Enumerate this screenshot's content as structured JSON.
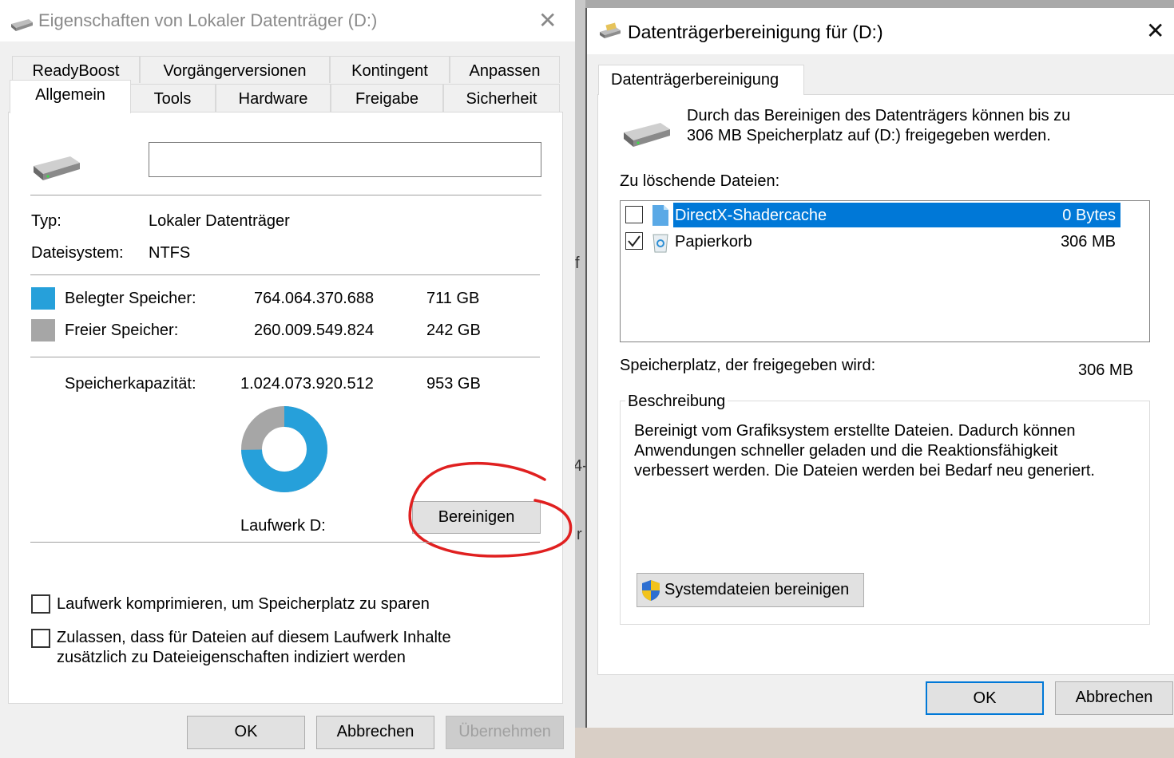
{
  "left_window": {
    "title": "Eigenschaften von Lokaler Datenträger (D:)",
    "tabs_row1": [
      "ReadyBoost",
      "Vorgängerversionen",
      "Kontingent",
      "Anpassen"
    ],
    "tabs_row2": [
      "Allgemein",
      "Tools",
      "Hardware",
      "Freigabe",
      "Sicherheit"
    ],
    "active_tab": "Allgemein",
    "name_value": "",
    "type_label": "Typ:",
    "type_value": "Lokaler Datenträger",
    "fs_label": "Dateisystem:",
    "fs_value": "NTFS",
    "used_label": "Belegter Speicher:",
    "used_bytes": "764.064.370.688",
    "used_gb": "711 GB",
    "free_label": "Freier Speicher:",
    "free_bytes": "260.009.549.824",
    "free_gb": "242 GB",
    "capacity_label": "Speicherkapazität:",
    "capacity_bytes": "1.024.073.920.512",
    "capacity_gb": "953 GB",
    "drive_label": "Laufwerk D:",
    "cleanup_button": "Bereinigen",
    "compress_label": "Laufwerk komprimieren, um Speicherplatz zu sparen",
    "index_label_line1": "Zulassen, dass für Dateien auf diesem Laufwerk Inhalte",
    "index_label_line2": "zusätzlich zu Dateieigenschaften indiziert werden",
    "ok_button": "OK",
    "cancel_button": "Abbrechen",
    "apply_button": "Übernehmen",
    "used_color": "#26a0da",
    "free_color": "#a6a6a6",
    "used_fraction": 0.746
  },
  "right_window": {
    "title": "Datenträgerbereinigung für  (D:)",
    "tab": "Datenträgerbereinigung",
    "intro_line1": "Durch das Bereinigen des Datenträgers können bis zu",
    "intro_line2": "306 MB Speicherplatz auf  (D:) freigegeben werden.",
    "files_label": "Zu löschende Dateien:",
    "files": [
      {
        "name": "DirectX-Shadercache",
        "size": "0 Bytes",
        "checked": false,
        "selected": true,
        "icon": "file-icon"
      },
      {
        "name": "Papierkorb",
        "size": "306 MB",
        "checked": true,
        "selected": false,
        "icon": "recycle-bin-icon"
      }
    ],
    "space_label": "Speicherplatz, der freigegeben wird:",
    "space_value": "306 MB",
    "description_title": "Beschreibung",
    "description_line1": "Bereinigt vom Grafiksystem erstellte Dateien. Dadurch können",
    "description_line2": "Anwendungen schneller geladen und die Reaktionsfähigkeit",
    "description_line3": "verbessert werden. Die Dateien werden bei Bedarf neu generiert.",
    "system_button": "Systemdateien bereinigen",
    "ok_button": "OK",
    "cancel_button": "Abbrechen"
  },
  "background_fragments": [
    "f",
    "4-",
    "r"
  ]
}
